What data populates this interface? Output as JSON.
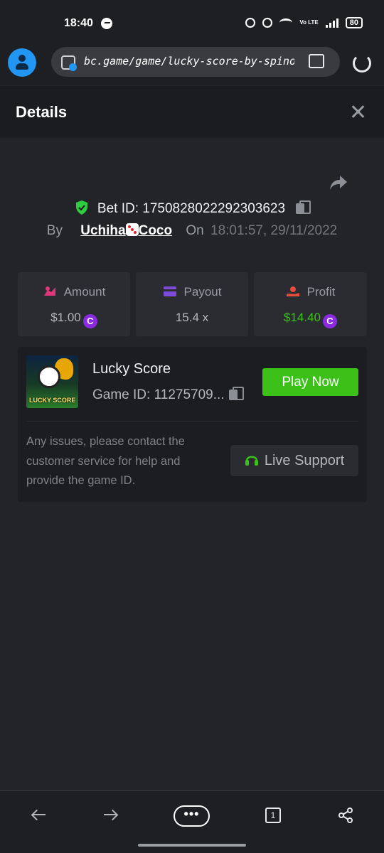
{
  "status_bar": {
    "time": "18:40",
    "battery": "80",
    "volte": "Vo LTE"
  },
  "browser": {
    "url": "bc.game/game/lucky-score-by-spinomenal"
  },
  "details": {
    "title": "Details",
    "bet_label": "Bet ID:",
    "bet_id": "1750828022292303623",
    "by_label": "By",
    "username_part1": "Uchiha",
    "username_part2": "Coco",
    "on_label": "On",
    "datetime": "18:01:57, 29/11/2022"
  },
  "stats": {
    "amount_label": "Amount",
    "amount_value": "$1.00",
    "payout_label": "Payout",
    "payout_value": "15.4 x",
    "profit_label": "Profit",
    "profit_value": "$14.40"
  },
  "game": {
    "thumbnail_text": "LUCKY SCORE",
    "name": "Lucky Score",
    "id_label": "Game ID:",
    "id_value": "11275709...",
    "play_label": "Play Now",
    "help_text": "Any issues, please contact the customer service for help and provide the game ID.",
    "support_label": "Live Support"
  },
  "bottom_nav": {
    "more_label": "•••",
    "tab_count": "1"
  },
  "colors": {
    "background": "#232428",
    "accent_green": "#3bc117",
    "profit_green": "#3bc117",
    "coin_purple": "#8a2be2",
    "amount_icon": "#e0357a",
    "payout_icon": "#7d4cdb",
    "profit_icon": "#e74c3c"
  },
  "icons": [
    "messenger-icon",
    "alarm-icon",
    "mute-icon",
    "wifi-icon",
    "signal-icon",
    "battery-icon",
    "avatar-icon",
    "lock-icon",
    "reader-mode-icon",
    "reload-icon",
    "close-icon",
    "share-icon",
    "shield-icon",
    "copy-icon",
    "dice-icon",
    "amount-icon",
    "payout-icon",
    "profit-icon",
    "coin-icon",
    "headset-icon",
    "back-arrow-icon",
    "forward-arrow-icon",
    "more-icon",
    "tabs-icon",
    "share-nodes-icon"
  ]
}
